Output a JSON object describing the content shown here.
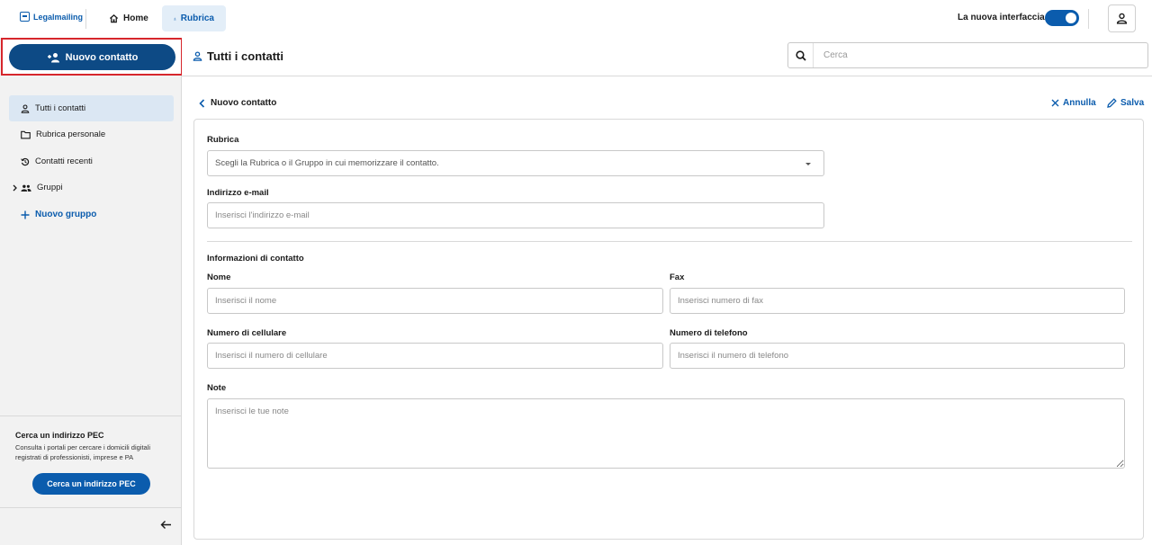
{
  "topbar": {
    "logo_text": "Legalmailing",
    "nav": [
      {
        "label": "Home",
        "icon": "home-icon"
      },
      {
        "label": "Rubrica",
        "icon": "person-icon"
      }
    ],
    "toggle_label": "La nuova interfaccia",
    "toggle_on": true
  },
  "sidebar": {
    "new_contact_label": "Nuovo contatto",
    "items": [
      {
        "label": "Tutti i contatti",
        "icon": "person-icon",
        "active": true
      },
      {
        "label": "Rubrica personale",
        "icon": "folder-icon"
      },
      {
        "label": "Contatti recenti",
        "icon": "history-icon"
      },
      {
        "label": "Gruppi",
        "icon": "group-icon"
      }
    ],
    "add_group_label": "Nuovo gruppo",
    "pec": {
      "title": "Cerca un indirizzo PEC",
      "text": "Consulta i portali per cercare i domicili digitali registrati di professionisti, imprese e PA",
      "button": "Cerca un indirizzo PEC"
    }
  },
  "main": {
    "title": "Tutti i contatti",
    "search_placeholder": "Cerca",
    "back_label": "Nuovo contatto",
    "cancel_label": "Annulla",
    "save_label": "Salva",
    "accent": "#0b5cad"
  },
  "form": {
    "rubrica_label": "Rubrica",
    "rubrica_value": "Scegli la Rubrica o il Gruppo in cui memorizzare il contatto.",
    "email_label": "Indirizzo e-mail",
    "email_placeholder": "Inserisci l'indirizzo e-mail",
    "section_title": "Informazioni di contatto",
    "name_label": "Nome",
    "name_placeholder": "Inserisci il nome",
    "fax_label": "Fax",
    "fax_placeholder": "Inserisci numero di fax",
    "mobile_label": "Numero di cellulare",
    "mobile_placeholder": "Inserisci il numero di cellulare",
    "phone_label": "Numero di telefono",
    "phone_placeholder": "Inserisci il numero di telefono",
    "notes_label": "Note",
    "notes_placeholder": "Inserisci le tue note"
  }
}
